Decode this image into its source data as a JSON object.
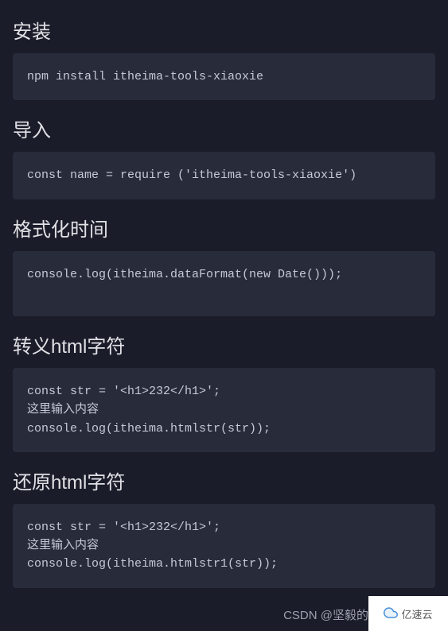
{
  "sections": [
    {
      "heading": "安装",
      "code": "npm install itheima-tools-xiaoxie"
    },
    {
      "heading": "导入",
      "code": "const name = require ('itheima-tools-xiaoxie')"
    },
    {
      "heading": "格式化时间",
      "code": "console.log(itheima.dataFormat(new Date()));\n "
    },
    {
      "heading": "转义html字符",
      "code": "const str = '<h1>232</h1>';\n这里输入内容\nconsole.log(itheima.htmlstr(str));"
    },
    {
      "heading": "还原html字符",
      "code": "const str = '<h1>232</h1>';\n这里输入内容\nconsole.log(itheima.htmlstr1(str));"
    }
  ],
  "watermark": "CSDN @坚毅的",
  "brand": {
    "label": "亿速云"
  }
}
